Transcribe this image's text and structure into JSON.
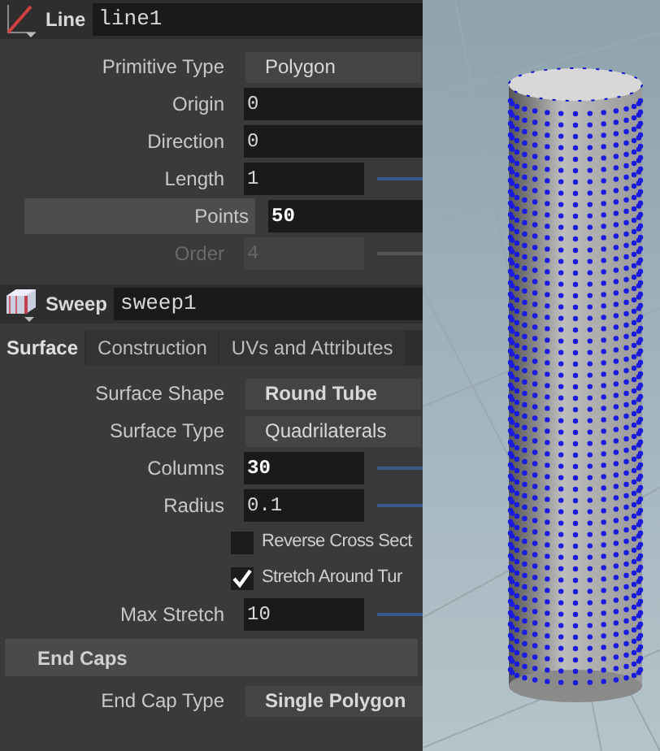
{
  "nodes": [
    {
      "kind": "line",
      "type_label": "Line",
      "name": "line1",
      "params": [
        {
          "kind": "dropdown",
          "label": "Primitive Type",
          "value": "Polygon",
          "modified": false,
          "highlighted": false,
          "disabled": false
        },
        {
          "kind": "field",
          "label": "Origin",
          "value": "0",
          "modified": false,
          "highlighted": false,
          "disabled": false
        },
        {
          "kind": "field",
          "label": "Direction",
          "value": "0",
          "modified": false,
          "highlighted": false,
          "disabled": false
        },
        {
          "kind": "slider",
          "label": "Length",
          "value": "1",
          "modified": false,
          "highlighted": false,
          "disabled": false
        },
        {
          "kind": "field",
          "label": "Points",
          "value": "50",
          "modified": true,
          "highlighted": true,
          "disabled": false
        },
        {
          "kind": "slider",
          "label": "Order",
          "value": "4",
          "modified": false,
          "highlighted": false,
          "disabled": true
        }
      ]
    },
    {
      "kind": "sweep",
      "type_label": "Sweep",
      "name": "sweep1",
      "tabs": [
        {
          "label": "Surface",
          "selected": true
        },
        {
          "label": "Construction",
          "selected": false
        },
        {
          "label": "UVs and Attributes",
          "selected": false
        }
      ],
      "params": [
        {
          "kind": "dropdown",
          "label": "Surface Shape",
          "value": "Round Tube",
          "modified": true,
          "highlighted": false,
          "disabled": false
        },
        {
          "kind": "dropdown",
          "label": "Surface Type",
          "value": "Quadrilaterals",
          "modified": false,
          "highlighted": false,
          "disabled": false
        },
        {
          "kind": "slider",
          "label": "Columns",
          "value": "30",
          "modified": true,
          "highlighted": false,
          "disabled": false
        },
        {
          "kind": "slider",
          "label": "Radius",
          "value": "0.1",
          "modified": false,
          "highlighted": false,
          "disabled": false
        },
        {
          "kind": "checkbox",
          "label": "Reverse Cross Sect",
          "checked": false
        },
        {
          "kind": "checkbox",
          "label": "Stretch Around Tur",
          "checked": true
        },
        {
          "kind": "slider",
          "label": "Max Stretch",
          "value": "10",
          "modified": false,
          "highlighted": false,
          "disabled": false
        },
        {
          "kind": "section",
          "label": "End Caps"
        },
        {
          "kind": "dropdown",
          "label": "End Cap Type",
          "value": "Single Polygon",
          "modified": true,
          "highlighted": false,
          "disabled": false
        }
      ]
    }
  ]
}
